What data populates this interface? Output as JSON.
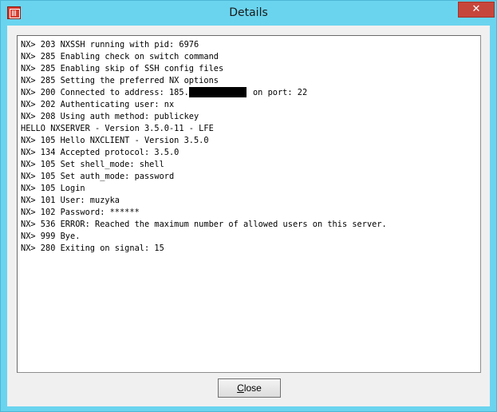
{
  "window": {
    "title": "Details",
    "close_glyph": "✕"
  },
  "log": {
    "lines": [
      "NX> 203 NXSSH running with pid: 6976",
      "NX> 285 Enabling check on switch command",
      "NX> 285 Enabling skip of SSH config files",
      "NX> 285 Setting the preferred NX options",
      "NX> 202 Authenticating user: nx",
      "NX> 208 Using auth method: publickey",
      "HELLO NXSERVER - Version 3.5.0-11 - LFE",
      "NX> 105 Hello NXCLIENT - Version 3.5.0",
      "NX> 134 Accepted protocol: 3.5.0",
      "NX> 105 Set shell_mode: shell",
      "NX> 105 Set auth_mode: password",
      "NX> 105 Login",
      "NX> 101 User: muzyka",
      "NX> 102 Password: ******",
      "NX> 536 ERROR: Reached the maximum number of allowed users on this server.",
      "NX> 999 Bye.",
      "NX> 280 Exiting on signal: 15"
    ],
    "connected_prefix": "NX> 200 Connected to address: 185.",
    "connected_suffix": " on port: 22"
  },
  "footer": {
    "close_accel": "C",
    "close_rest": "lose"
  }
}
